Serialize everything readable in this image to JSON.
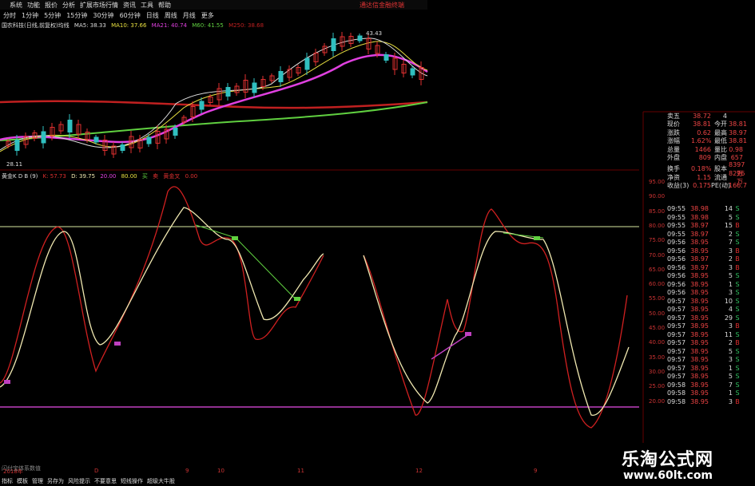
{
  "menu": {
    "items": [
      "系统",
      "功能",
      "报价",
      "分析",
      "扩展市场行情",
      "资讯",
      "工具",
      "帮助"
    ],
    "app_title": "通达信金融终端"
  },
  "periods": [
    "分时",
    "1分钟",
    "5分钟",
    "15分钟",
    "30分钟",
    "60分钟",
    "日线",
    "周线",
    "月线",
    "更多"
  ],
  "ma_legend": {
    "title": "国农科技(日线,前复权)均线",
    "ma5": "MA5: 38.33",
    "ma10": "MA10: 37.66",
    "ma21": "MA21: 40.74",
    "ma60": "M60: 41.55",
    "ma250": "M250: 38.68"
  },
  "kdj_legend": {
    "title": "黄金K D B (9)",
    "k": "K: 57.73",
    "d": "D: 39.75",
    "v1": "20.00",
    "v2": "80.00",
    "buy": "买",
    "sell": "卖",
    "gold": "黄金叉",
    "gold_val": "0.00"
  },
  "price_marks": {
    "high": "43.43",
    "low": "28.11"
  },
  "right_axis": [
    "95.00",
    "90.00",
    "85.00",
    "80.00",
    "75.00",
    "70.00",
    "65.00",
    "60.00",
    "55.00",
    "50.00",
    "45.00",
    "40.00",
    "35.00",
    "30.00",
    "25.00",
    "20.00"
  ],
  "quote": [
    {
      "c1": "卖五",
      "c2": "38.72",
      "c3": "4"
    },
    {
      "c1": "现价",
      "c2": "38.81",
      "c3": "今开",
      "c5": "38.81"
    },
    {
      "c1": "涨跌",
      "c2": "0.62",
      "c3": "最高",
      "c5": "38.97"
    },
    {
      "c1": "涨幅",
      "c2": "1.62%",
      "c3": "最低",
      "c5": "38.81"
    },
    {
      "c1": "总量",
      "c2": "1466",
      "c3": "量比",
      "c5": "0.98"
    },
    {
      "c1": "外盘",
      "c2": "809",
      "c3": "内盘",
      "c5": "657"
    },
    {
      "c1": "换手",
      "c2": "0.18%",
      "c3": "股本",
      "c5": "8397万"
    },
    {
      "c1": "净资",
      "c2": "1.15",
      "c3": "流通",
      "c5": "8296万"
    },
    {
      "c1": "收益(3)",
      "c2": "0.175",
      "c3": "PE(动)",
      "c5": "166.7"
    }
  ],
  "trades": [
    {
      "t": "09:55",
      "p": "38.98",
      "v": "14",
      "s": "S"
    },
    {
      "t": "09:55",
      "p": "38.98",
      "v": "5",
      "s": "S"
    },
    {
      "t": "09:55",
      "p": "38.97",
      "v": "15",
      "s": "B"
    },
    {
      "t": "09:55",
      "p": "38.97",
      "v": "2",
      "s": "S"
    },
    {
      "t": "09:56",
      "p": "38.95",
      "v": "7",
      "s": "S"
    },
    {
      "t": "09:56",
      "p": "38.95",
      "v": "3",
      "s": "B"
    },
    {
      "t": "09:56",
      "p": "38.97",
      "v": "2",
      "s": "B"
    },
    {
      "t": "09:56",
      "p": "38.97",
      "v": "3",
      "s": "B"
    },
    {
      "t": "09:56",
      "p": "38.95",
      "v": "5",
      "s": "S"
    },
    {
      "t": "09:56",
      "p": "38.95",
      "v": "1",
      "s": "S"
    },
    {
      "t": "09:56",
      "p": "38.95",
      "v": "3",
      "s": "S"
    },
    {
      "t": "09:57",
      "p": "38.95",
      "v": "10",
      "s": "S"
    },
    {
      "t": "09:57",
      "p": "38.95",
      "v": "4",
      "s": "S"
    },
    {
      "t": "09:57",
      "p": "38.95",
      "v": "29",
      "s": "S"
    },
    {
      "t": "09:57",
      "p": "38.95",
      "v": "3",
      "s": "B"
    },
    {
      "t": "09:57",
      "p": "38.95",
      "v": "11",
      "s": "S"
    },
    {
      "t": "09:57",
      "p": "38.95",
      "v": "2",
      "s": "B"
    },
    {
      "t": "09:57",
      "p": "38.95",
      "v": "5",
      "s": "S"
    },
    {
      "t": "09:57",
      "p": "38.95",
      "v": "3",
      "s": "S"
    },
    {
      "t": "09:57",
      "p": "38.95",
      "v": "1",
      "s": "S"
    },
    {
      "t": "09:57",
      "p": "38.95",
      "v": "5",
      "s": "S"
    },
    {
      "t": "09:58",
      "p": "38.95",
      "v": "7",
      "s": "S"
    },
    {
      "t": "09:58",
      "p": "38.95",
      "v": "1",
      "s": "S"
    },
    {
      "t": "09:58",
      "p": "38.95",
      "v": "3",
      "s": "B"
    }
  ],
  "dates": [
    "2018年",
    "D",
    "9",
    "10",
    "11",
    "12",
    "9"
  ],
  "bottom_tabs": [
    "指标",
    "模板",
    "管理",
    "另存为",
    "风险提示",
    "不要意思",
    "短线操作",
    "超级大牛股"
  ],
  "indicator_label": "闪付宝体系数值",
  "watermark": {
    "title": "乐淘公式网",
    "url": "www.60lt.com"
  },
  "colors": {
    "up": "#e03030",
    "down": "#30c0c0",
    "ma_pink": "#e040e0",
    "ma_red": "#c02020",
    "ma_green": "#60d040",
    "k_line": "#f0e8b0",
    "d_line": "#d02020",
    "guide": "#c040c0"
  }
}
